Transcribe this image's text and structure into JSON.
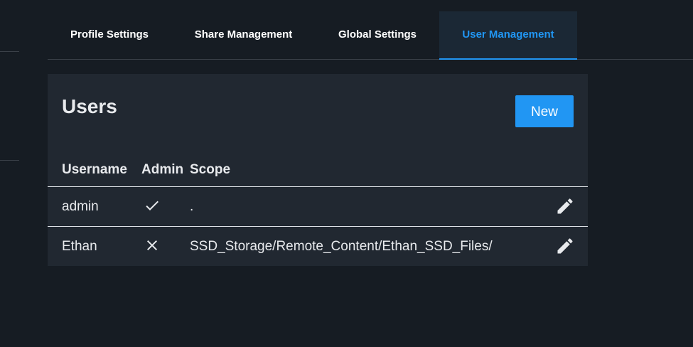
{
  "tabs": [
    {
      "label": "Profile Settings",
      "active": false
    },
    {
      "label": "Share Management",
      "active": false
    },
    {
      "label": "Global Settings",
      "active": false
    },
    {
      "label": "User Management",
      "active": true
    }
  ],
  "users_card": {
    "title": "Users",
    "new_button_label": "New",
    "columns": [
      "Username",
      "Admin",
      "Scope"
    ],
    "rows": [
      {
        "username": "admin",
        "admin": true,
        "admin_icon": "check-icon",
        "scope": ".",
        "edit_icon": "pencil-icon"
      },
      {
        "username": "Ethan",
        "admin": false,
        "admin_icon": "close-icon",
        "scope": "SSD_Storage/Remote_Content/Ethan_SSD_Files/",
        "edit_icon": "pencil-icon"
      }
    ]
  },
  "colors": {
    "background": "#161c23",
    "card": "#212831",
    "accent": "#2196f3",
    "active_tab_bg": "#1b2835",
    "text": "#e8eaed"
  }
}
